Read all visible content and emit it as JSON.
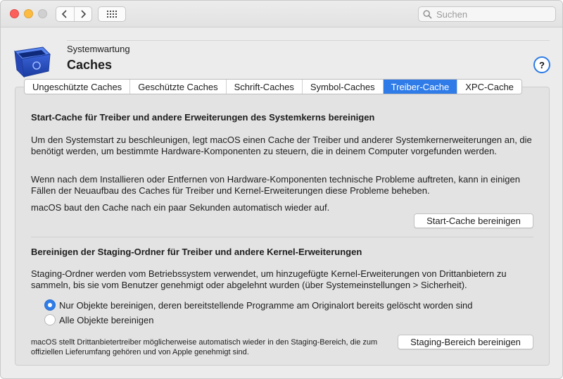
{
  "toolbar": {
    "search_placeholder": "Suchen",
    "icons": [
      "back-icon",
      "forward-icon",
      "grid-icon",
      "search-icon"
    ]
  },
  "header": {
    "subtitle": "Systemwartung",
    "title": "Caches",
    "help_label": "?",
    "app_icon": "blue-bin-icon"
  },
  "tabs": [
    {
      "label": "Ungeschützte Caches",
      "active": false
    },
    {
      "label": "Geschützte Caches",
      "active": false
    },
    {
      "label": "Schrift-Caches",
      "active": false
    },
    {
      "label": "Symbol-Caches",
      "active": false
    },
    {
      "label": "Treiber-Cache",
      "active": true
    },
    {
      "label": "XPC-Cache",
      "active": false
    }
  ],
  "section1": {
    "heading": "Start-Cache für Treiber und andere Erweiterungen des Systemkerns bereinigen",
    "para1": "Um den Systemstart zu beschleunigen, legt macOS einen Cache der Treiber und anderer Systemkernerweiterungen an, die benötigt werden, um bestimmte Hardware-Komponenten zu steuern, die in deinem Computer vorgefunden werden.",
    "para2": "Wenn nach dem Installieren oder Entfernen von Hardware-Komponenten technische Probleme auftreten, kann in einigen Fällen der Neuaufbau des Caches für Treiber und Kernel-Erweiterungen diese Probleme beheben.",
    "para3": "macOS baut den Cache nach ein paar Sekunden automatisch wieder auf.",
    "button": "Start-Cache bereinigen"
  },
  "section2": {
    "heading": "Bereinigen der Staging-Ordner für Treiber und andere Kernel-Erweiterungen",
    "para1": "Staging-Ordner werden vom Betriebssystem verwendet, um hinzugefügte Kernel-Erweiterungen von Drittanbietern zu sammeln, bis sie vom Benutzer genehmigt oder abgelehnt wurden (über Systemeinstellungen > Sicherheit).",
    "radio1": "Nur Objekte bereinigen, deren bereitstellende Programme am Originalort bereits gelöscht worden sind",
    "radio1_checked": true,
    "radio2": "Alle Objekte bereinigen",
    "radio2_checked": false,
    "footnote": "macOS stellt Drittanbietertreiber möglicherweise automatisch wieder in den Staging-Bereich, die zum offiziellen Lieferumfang gehören und von Apple genehmigt sind.",
    "button": "Staging-Bereich bereinigen"
  },
  "colors": {
    "accent": "#2f7ce8",
    "close": "#fc605c",
    "minimize": "#fdbc40",
    "maximize_disabled": "#d0d0d0"
  }
}
